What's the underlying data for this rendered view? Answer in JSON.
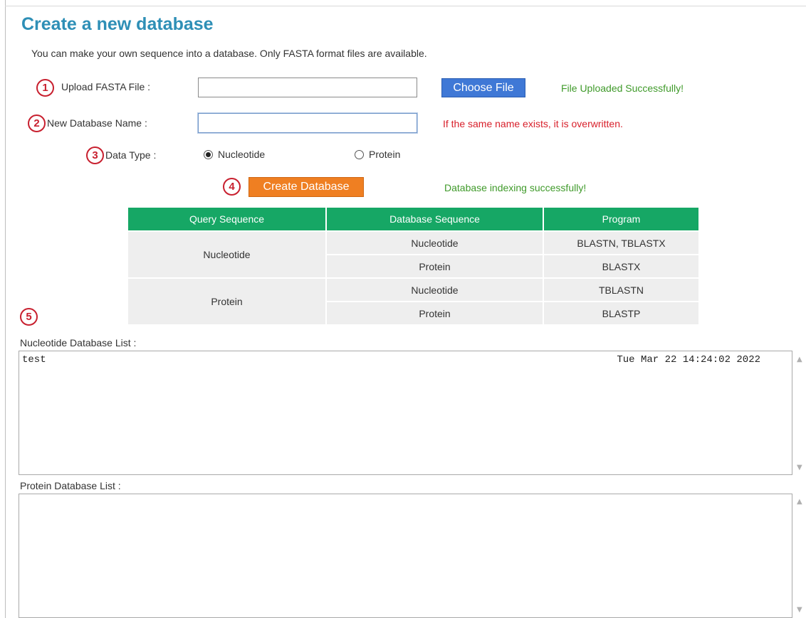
{
  "title": "Create a new database",
  "intro": "You can make your own sequence into a database. Only FASTA format files are available.",
  "markers": [
    "1",
    "2",
    "3",
    "4",
    "5"
  ],
  "upload": {
    "label": "Upload FASTA File :",
    "value": "",
    "button_label": "Choose File",
    "status": "File Uploaded Successfully!"
  },
  "db_name": {
    "label": "New Database Name :",
    "value": "",
    "warning": "If the same name exists, it is overwritten."
  },
  "data_type": {
    "label": "Data Type :",
    "options": [
      "Nucleotide",
      "Protein"
    ],
    "selected": "Nucleotide"
  },
  "create": {
    "button_label": "Create Database",
    "status": "Database indexing successfully!"
  },
  "program_table": {
    "headers": [
      "Query Sequence",
      "Database Sequence",
      "Program"
    ],
    "rows": [
      {
        "query": "Nucleotide",
        "database": "Nucleotide",
        "program": "BLASTN, TBLASTX"
      },
      {
        "query": "Nucleotide",
        "database": "Protein",
        "program": "BLASTX"
      },
      {
        "query": "Protein",
        "database": "Nucleotide",
        "program": "TBLASTN"
      },
      {
        "query": "Protein",
        "database": "Protein",
        "program": "BLASTP"
      }
    ]
  },
  "nucleotide_list": {
    "label": "Nucleotide Database List :",
    "items": [
      {
        "name": "test",
        "date": "Tue Mar 22 14:24:02 2022"
      }
    ]
  },
  "protein_list": {
    "label": "Protein Database List :",
    "items": []
  },
  "colors": {
    "title": "#2e8fb6",
    "marker": "#c8202f",
    "success": "#3f9a2a",
    "warning": "#d8202b",
    "table_header": "#16a765",
    "choose_button": "#3f78d6",
    "create_button": "#ef7f22"
  },
  "icons": {
    "scroll_up": "chevron-up-icon",
    "scroll_down": "chevron-down-icon",
    "radio_selected": "radio-checked-icon",
    "radio_empty": "radio-unchecked-icon"
  }
}
